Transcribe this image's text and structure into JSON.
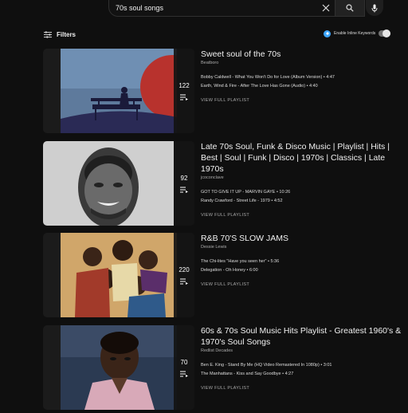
{
  "search": {
    "query": "70s soul songs"
  },
  "filters": {
    "label": "Filters"
  },
  "inline_keywords": {
    "label": "Enable Inline Keywords"
  },
  "results": [
    {
      "title": "Sweet soul of the 70s",
      "channel": "Beatboro",
      "count": "122",
      "videos": [
        {
          "title": "Bobby Caldwell - What You Won't Do for Love (Album Version)",
          "duration": "4:47"
        },
        {
          "title": "Earth, Wind & Fire - After The Love Has Gone (Audio)",
          "duration": "4:40"
        }
      ],
      "view_label": "VIEW FULL PLAYLIST"
    },
    {
      "title": "Late 70s Soul, Funk & Disco Music | Playlist | Hits | Best | Soul | Funk | Disco | 1970s | Classics | Late 1970s",
      "channel": "jcoconclave",
      "count": "92",
      "videos": [
        {
          "title": "GOT TO GIVE IT UP - MARVIN GAYE",
          "duration": "10:26"
        },
        {
          "title": "Randy Crawford - Street Life - 1979",
          "duration": "4:52"
        }
      ],
      "view_label": "VIEW FULL PLAYLIST"
    },
    {
      "title": "R&B 70'S SLOW JAMS",
      "channel": "Dessie Lewis",
      "count": "220",
      "videos": [
        {
          "title": "The Chi-lites \"Have you seen her\"",
          "duration": "5:36"
        },
        {
          "title": "Delegation - Oh Honey",
          "duration": "6:00"
        }
      ],
      "view_label": "VIEW FULL PLAYLIST"
    },
    {
      "title": "60s & 70s Soul Music Hits Playlist - Greatest 1960's & 1970's Soul Songs",
      "channel": "Redlist Decades",
      "count": "70",
      "videos": [
        {
          "title": "Ben E. King - Stand By Me (HQ Video Remastered In 1080p)",
          "duration": "3:01"
        },
        {
          "title": "The Manhattans - Kiss and Say Goodbye",
          "duration": "4:27"
        }
      ],
      "view_label": "VIEW FULL PLAYLIST"
    }
  ],
  "colors": {
    "background": "#0f0f0f",
    "accent": "#3ea6ff",
    "text": "#f1f1f1",
    "secondary": "#aaaaaa"
  }
}
